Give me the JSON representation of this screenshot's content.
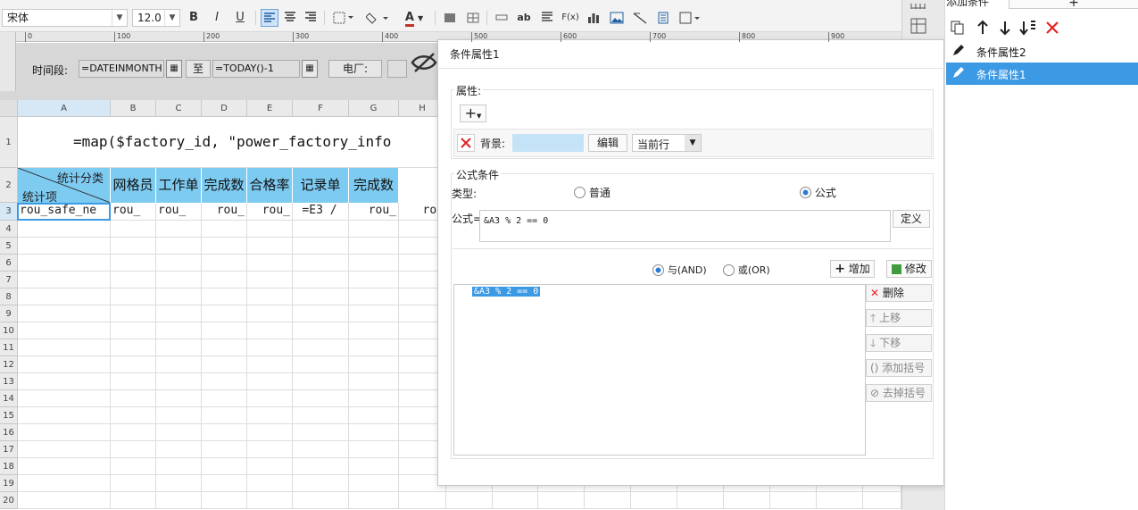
{
  "toolbar": {
    "font_name": "宋体",
    "font_size": "12.0",
    "bold": "B",
    "italic": "I",
    "underline": "U",
    "font_color_glyph": "A",
    "wrap_glyph": "ab",
    "formula_glyph": "F(x)"
  },
  "ruler": {
    "labels": [
      "0",
      "100",
      "200",
      "300",
      "400",
      "500",
      "600",
      "700",
      "800",
      "900"
    ]
  },
  "params": {
    "time_label": "时间段:",
    "start_value": "=DATEINMONTH",
    "to_label": "至",
    "end_value": "=TODAY()-1",
    "plant_label": "电厂:"
  },
  "sheet": {
    "columns": [
      "A",
      "B",
      "C",
      "D",
      "E",
      "F",
      "G",
      "H"
    ],
    "rows": [
      "1",
      "2",
      "3",
      "4",
      "5",
      "6",
      "7",
      "8",
      "9",
      "10",
      "11",
      "12",
      "13",
      "14",
      "15",
      "16",
      "17",
      "18",
      "19",
      "20"
    ],
    "row1_formula": "=map($factory_id, \"power_factory_info",
    "header_diag_top": "统计分类",
    "header_diag_bottom": "统计项",
    "headers": [
      "网格员",
      "工作单",
      "完成数",
      "合格率",
      "记录单",
      "完成数"
    ],
    "row3": [
      "rou_safe_ne",
      "rou_",
      "rou_",
      "rou_",
      "rou_",
      "=E3 /",
      "rou_",
      "rou"
    ]
  },
  "dialog": {
    "title": "条件属性1",
    "property_section": "属性:",
    "add_glyph": "+",
    "background_label": "背景:",
    "background_color": "#c5e3f6",
    "edit_button": "编辑",
    "scope_value": "当前行",
    "formula_section": "公式条件",
    "type_label": "类型:",
    "type_normal": "普通",
    "type_formula": "公式",
    "formula_label": "公式=",
    "formula_value": "&A3 % 2 == 0",
    "define_button": "定义",
    "and_label": "与(AND)",
    "or_label": "或(OR)",
    "add_button": "增加",
    "modify_button": "修改",
    "condition_item": "&A3 % 2 == 0",
    "delete_button": "删除",
    "move_up_button": "上移",
    "move_down_button": "下移",
    "add_bracket_button": "添加括号",
    "remove_bracket_button": "去掉括号"
  },
  "right_panel": {
    "header": "添加条件",
    "items": [
      "条件属性2",
      "条件属性1"
    ],
    "selected_index": 1
  },
  "colors": {
    "header_blue": "#7ecbf2",
    "selection_blue": "#3c99e4",
    "delete_red": "#e02424"
  }
}
